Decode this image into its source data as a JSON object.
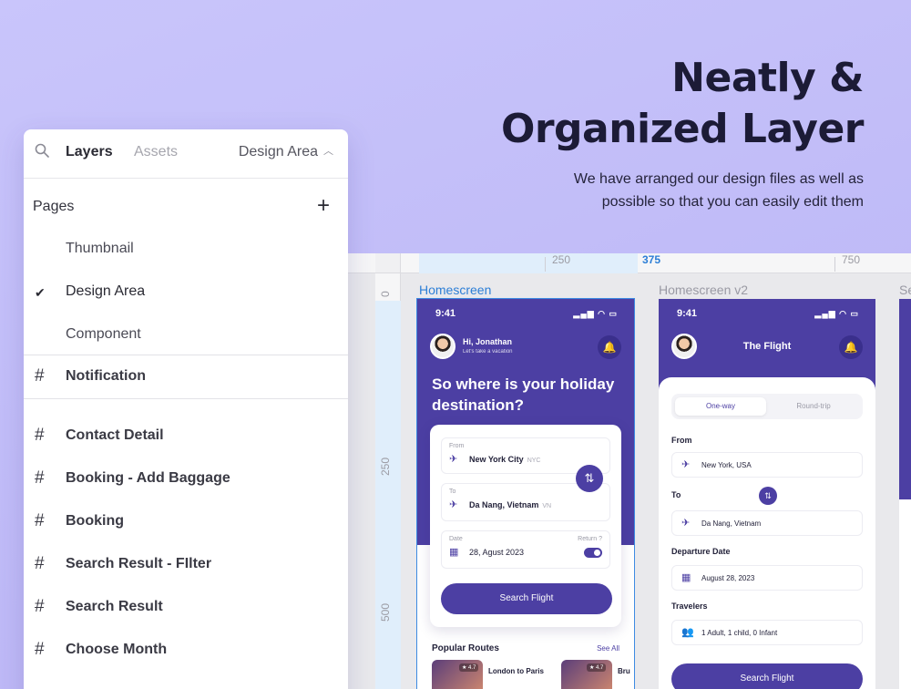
{
  "headline": {
    "title_line1": "Neatly &",
    "title_line2": "Organized Layer",
    "subtitle_line1": "We have arranged our design files as well as",
    "subtitle_line2": "possible so that you can easily edit them"
  },
  "panel": {
    "tabs": {
      "layers": "Layers",
      "assets": "Assets"
    },
    "current_page": "Design Area",
    "pages_label": "Pages",
    "pages": [
      "Thumbnail",
      "Design Area",
      "Component"
    ],
    "active_page_index": 1,
    "layers": [
      "Notification",
      "Contact Detail",
      "Booking - Add Baggage",
      "Booking",
      "Search Result - FIlter",
      "Search Result",
      "Choose Month"
    ]
  },
  "canvas": {
    "ruler_top": [
      "250",
      "375",
      "750"
    ],
    "ruler_left": [
      "0",
      "250",
      "500"
    ],
    "frames": [
      "Homescreen",
      "Homescreen v2",
      "Se"
    ]
  },
  "screen1": {
    "time": "9:41",
    "greeting": "Hi, Jonathan",
    "greeting_sub": "Let's take a vacation",
    "headline": "So where is your holiday destination?",
    "from_label": "From",
    "from_value": "New York City",
    "from_code": "NYC",
    "to_label": "To",
    "to_value": "Da Nang, Vietnam",
    "to_code": "VN",
    "date_label": "Date",
    "return_label": "Return ?",
    "date_value": "28, Agust 2023",
    "button": "Search Flight",
    "popular": "Popular Routes",
    "see_all": "See All",
    "routes": [
      {
        "rating": "★ 4.7",
        "name": "London to Paris"
      },
      {
        "rating": "★ 4.7",
        "name": "Bru"
      }
    ]
  },
  "screen2": {
    "time": "9:41",
    "title": "The Flight",
    "tab_oneway": "One-way",
    "tab_round": "Round-trip",
    "from_label": "From",
    "from_value": "New York, USA",
    "to_label": "To",
    "to_value": "Da Nang, Vietnam",
    "departure_label": "Departure Date",
    "departure_value": "August 28, 2023",
    "travelers_label": "Travelers",
    "travelers_value": "1 Adult, 1 child, 0 Infant",
    "button": "Search Flight"
  }
}
